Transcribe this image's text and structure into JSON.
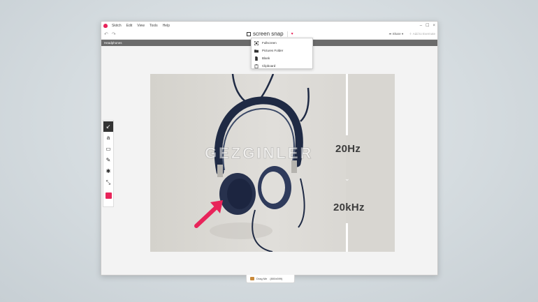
{
  "app": {
    "menus": [
      "Skitch",
      "Edit",
      "View",
      "Tools",
      "Help"
    ],
    "window_controls": [
      "–",
      "☐",
      "×"
    ]
  },
  "toolbar": {
    "undo": "↶",
    "redo": "↷",
    "snap_label": "screen snap",
    "share_label": "Share",
    "evernote_label": "Add to Evernote"
  },
  "tab": {
    "label": "Headphones"
  },
  "snap_menu": {
    "items": [
      {
        "label": "Fullscreen",
        "icon": "fullscreen-icon"
      },
      {
        "label": "Pictures Folder",
        "icon": "folder-icon"
      },
      {
        "label": "Blank",
        "icon": "blank-document-icon"
      },
      {
        "label": "Clipboard",
        "icon": "clipboard-icon"
      }
    ]
  },
  "canvas": {
    "freq_top": "20Hz",
    "freq_bottom": "20kHz",
    "watermark": "GEZGINLER"
  },
  "tools": [
    {
      "name": "arrow-tool",
      "glyph": "↙",
      "active": true
    },
    {
      "name": "text-tool",
      "glyph": "a"
    },
    {
      "name": "rectangle-tool",
      "glyph": "▭"
    },
    {
      "name": "marker-tool",
      "glyph": "✎"
    },
    {
      "name": "stamp-tool",
      "glyph": "✱"
    },
    {
      "name": "crop-tool",
      "glyph": "⤡"
    }
  ],
  "colors": {
    "accent": "#e8245a",
    "tabbar": "#6b6b6b",
    "headphone": "#1f2a44"
  },
  "status": {
    "label": "Drag Me",
    "size": "(800x599)"
  }
}
